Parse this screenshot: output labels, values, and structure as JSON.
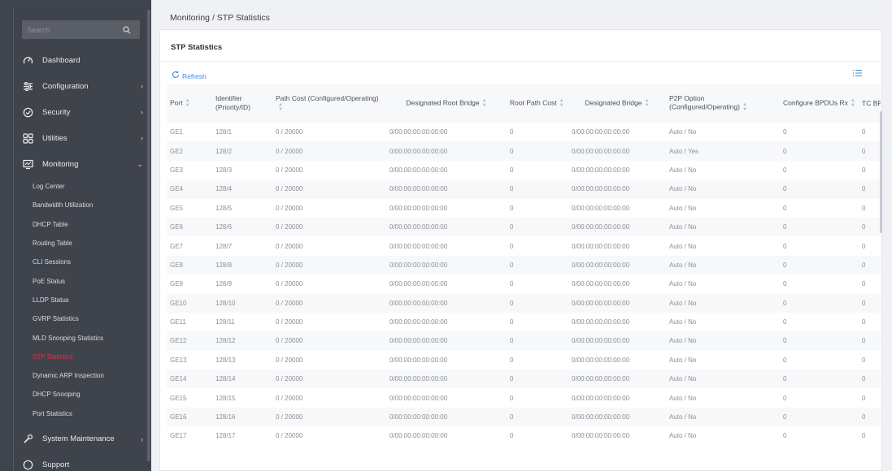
{
  "sidebar": {
    "search_placeholder": "Search",
    "items": [
      {
        "label": "Dashboard",
        "icon": "gauge-icon"
      },
      {
        "label": "Configuration",
        "icon": "sliders-icon"
      },
      {
        "label": "Security",
        "icon": "shield-icon"
      },
      {
        "label": "Utilities",
        "icon": "grid-icon"
      },
      {
        "label": "Monitoring",
        "icon": "monitor-icon"
      }
    ],
    "monitoring_sub": [
      "Log Center",
      "Bandwidth Utilization",
      "DHCP Table",
      "Routing Table",
      "CLI Sessions",
      "PoE Status",
      "LLDP Status",
      "GVRP Statistics",
      "MLD Snooping Statistics",
      "STP Statistics",
      "Dynamic ARP Inspection",
      "DHCP Snooping",
      "Port Statistics"
    ],
    "system_maintenance": "System Maintenance",
    "support": "Support"
  },
  "breadcrumb": "Monitoring /  STP Statistics",
  "card_title": "STP Statistics",
  "refresh_label": "Refresh",
  "colors": {
    "accent": "#3b8ee8",
    "active": "#e0334a",
    "sidebar": "#40444d"
  },
  "table": {
    "headers": [
      "Port",
      "Identifier (Priority/ID)",
      "Path Cost (Configured/Operating)",
      "Designated Root Bridge",
      "Root Path Cost",
      "Designated Bridge",
      "P2P Option (Configured/Operating)",
      "Configure BPDUs Rx",
      "TC BP"
    ],
    "rows": [
      [
        "GE1",
        "128/1",
        "0 / 20000",
        "0/00:00:00:00:00:00",
        "0",
        "0/00:00:00:00:00:00",
        "Auto / No",
        "0",
        "0"
      ],
      [
        "GE2",
        "128/2",
        "0 / 20000",
        "0/00:00:00:00:00:00",
        "0",
        "0/00:00:00:00:00:00",
        "Auto / Yes",
        "0",
        "0"
      ],
      [
        "GE3",
        "128/3",
        "0 / 20000",
        "0/00:00:00:00:00:00",
        "0",
        "0/00:00:00:00:00:00",
        "Auto / No",
        "0",
        "0"
      ],
      [
        "GE4",
        "128/4",
        "0 / 20000",
        "0/00:00:00:00:00:00",
        "0",
        "0/00:00:00:00:00:00",
        "Auto / No",
        "0",
        "0"
      ],
      [
        "GE5",
        "128/5",
        "0 / 20000",
        "0/00:00:00:00:00:00",
        "0",
        "0/00:00:00:00:00:00",
        "Auto / No",
        "0",
        "0"
      ],
      [
        "GE6",
        "128/6",
        "0 / 20000",
        "0/00:00:00:00:00:00",
        "0",
        "0/00:00:00:00:00:00",
        "Auto / No",
        "0",
        "0"
      ],
      [
        "GE7",
        "128/7",
        "0 / 20000",
        "0/00:00:00:00:00:00",
        "0",
        "0/00:00:00:00:00:00",
        "Auto / No",
        "0",
        "0"
      ],
      [
        "GE8",
        "128/8",
        "0 / 20000",
        "0/00:00:00:00:00:00",
        "0",
        "0/00:00:00:00:00:00",
        "Auto / No",
        "0",
        "0"
      ],
      [
        "GE9",
        "128/9",
        "0 / 20000",
        "0/00:00:00:00:00:00",
        "0",
        "0/00:00:00:00:00:00",
        "Auto / No",
        "0",
        "0"
      ],
      [
        "GE10",
        "128/10",
        "0 / 20000",
        "0/00:00:00:00:00:00",
        "0",
        "0/00:00:00:00:00:00",
        "Auto / No",
        "0",
        "0"
      ],
      [
        "GE11",
        "128/11",
        "0 / 20000",
        "0/00:00:00:00:00:00",
        "0",
        "0/00:00:00:00:00:00",
        "Auto / No",
        "0",
        "0"
      ],
      [
        "GE12",
        "128/12",
        "0 / 20000",
        "0/00:00:00:00:00:00",
        "0",
        "0/00:00:00:00:00:00",
        "Auto / No",
        "0",
        "0"
      ],
      [
        "GE13",
        "128/13",
        "0 / 20000",
        "0/00:00:00:00:00:00",
        "0",
        "0/00:00:00:00:00:00",
        "Auto / No",
        "0",
        "0"
      ],
      [
        "GE14",
        "128/14",
        "0 / 20000",
        "0/00:00:00:00:00:00",
        "0",
        "0/00:00:00:00:00:00",
        "Auto / No",
        "0",
        "0"
      ],
      [
        "GE15",
        "128/15",
        "0 / 20000",
        "0/00:00:00:00:00:00",
        "0",
        "0/00:00:00:00:00:00",
        "Auto / No",
        "0",
        "0"
      ],
      [
        "GE16",
        "128/16",
        "0 / 20000",
        "0/00:00:00:00:00:00",
        "0",
        "0/00:00:00:00:00:00",
        "Auto / No",
        "0",
        "0"
      ],
      [
        "GE17",
        "128/17",
        "0 / 20000",
        "0/00:00:00:00:00:00",
        "0",
        "0/00:00:00:00:00:00",
        "Auto / No",
        "0",
        "0"
      ]
    ]
  }
}
